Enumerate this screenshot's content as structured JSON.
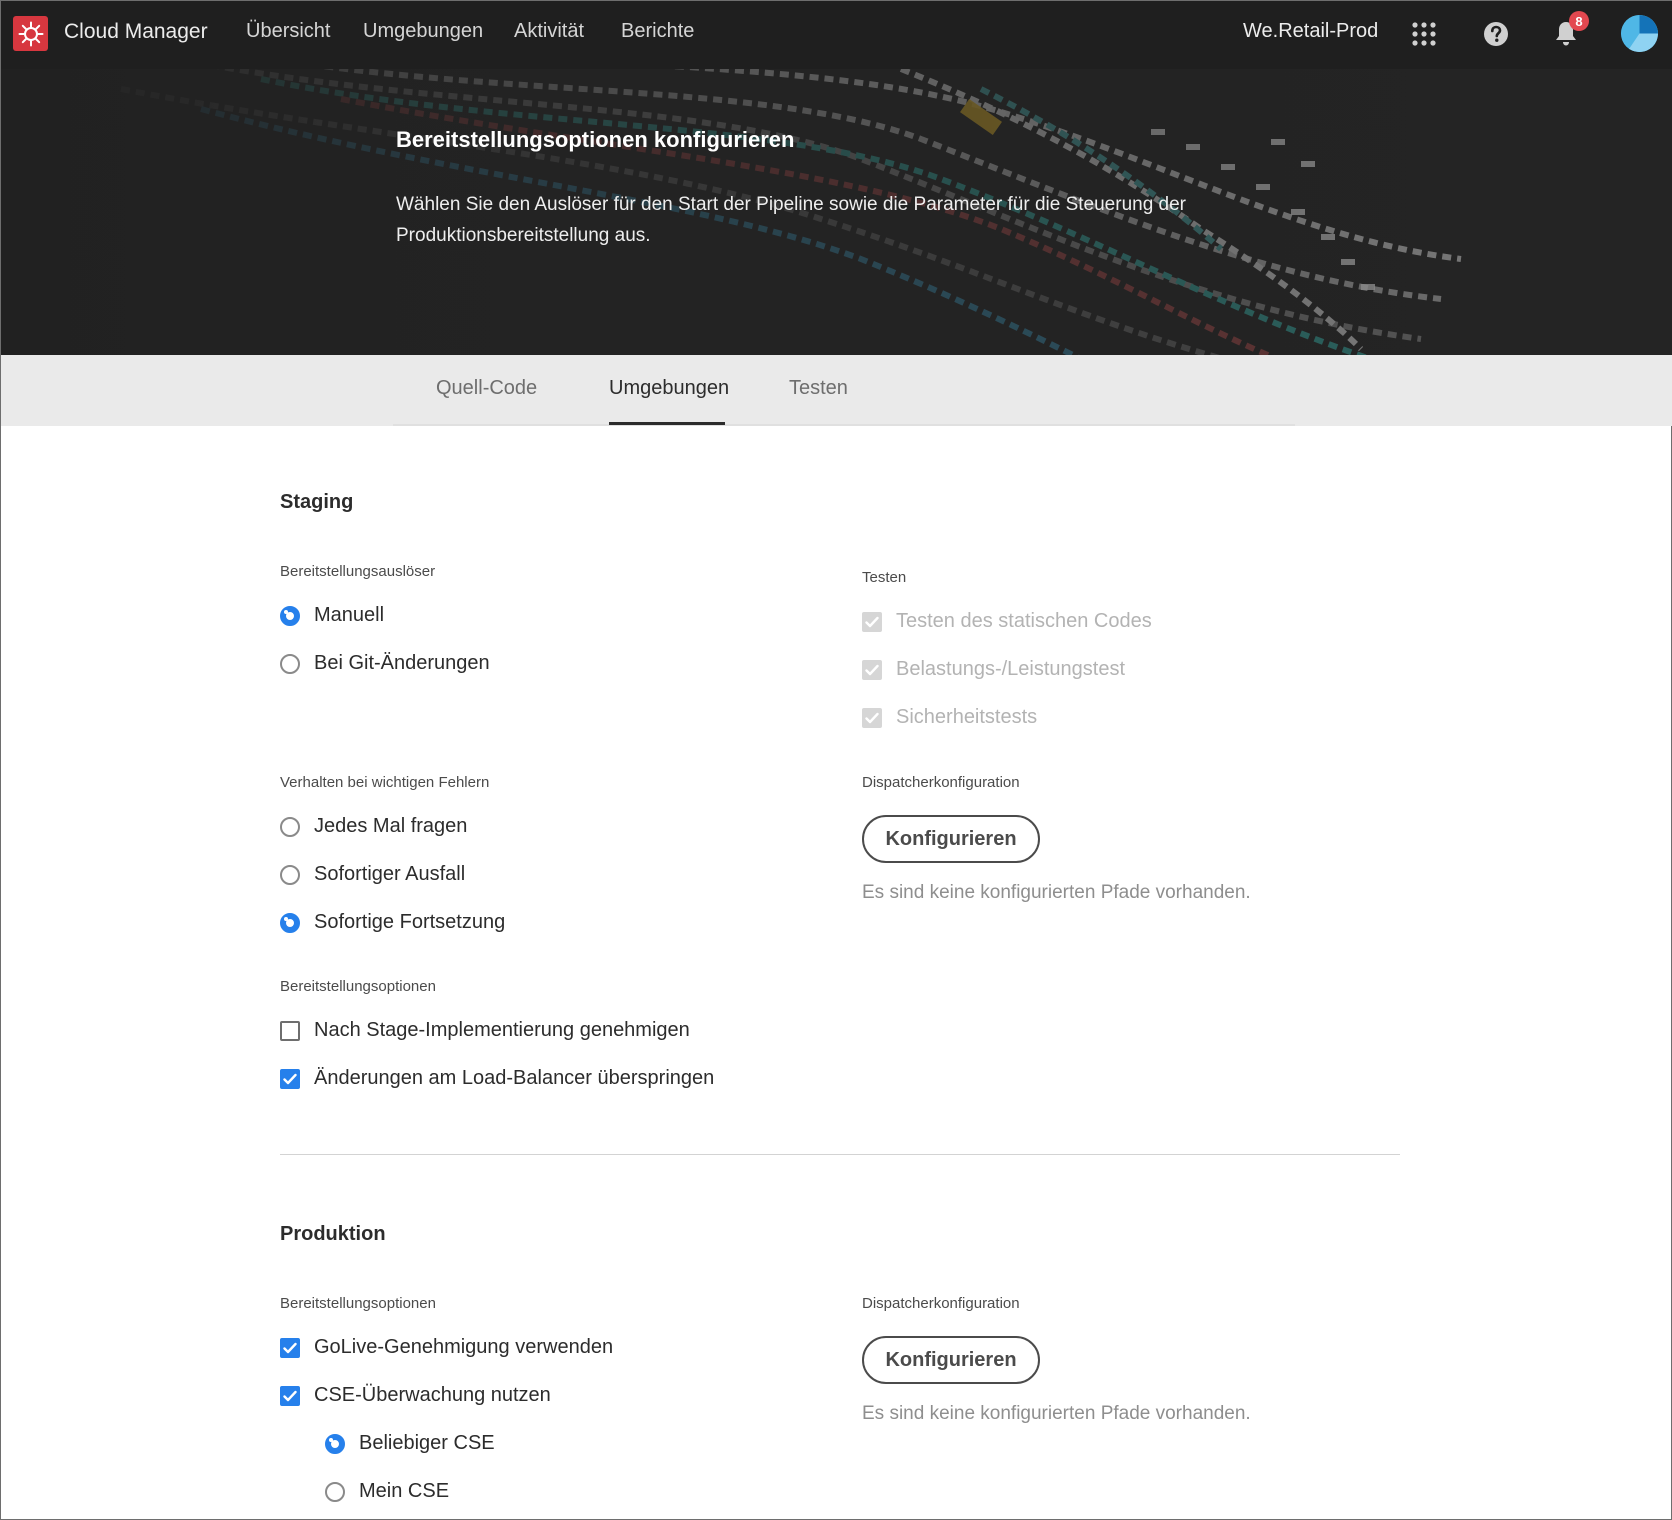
{
  "app": {
    "title": "Cloud Manager",
    "logo_icon": "adobe-experience-cloud-icon",
    "accent_color": "#2680eb",
    "brand_color": "#d7373f"
  },
  "nav": {
    "links": [
      "Übersicht",
      "Umgebungen",
      "Aktivität",
      "Berichte"
    ],
    "org": "We.Retail-Prod",
    "notification_count": "8",
    "icons": [
      "apps-grid-icon",
      "help-icon",
      "bell-icon",
      "avatar"
    ]
  },
  "hero": {
    "title": "Bereitstellungsoptionen konfigurieren",
    "description": "Wählen Sie den Auslöser für den Start der Pipeline sowie die Parameter für die Steuerung der Produktionsbereitstellung aus."
  },
  "tabs": {
    "items": [
      "Quell-Code",
      "Umgebungen",
      "Testen"
    ],
    "active": "Umgebungen"
  },
  "staging": {
    "title": "Staging",
    "trigger": {
      "label": "Bereitstellungsauslöser",
      "options": [
        "Manuell",
        "Bei Git-Änderungen"
      ],
      "selected": "Manuell"
    },
    "failure": {
      "label": "Verhalten bei wichtigen Fehlern",
      "options": [
        "Jedes Mal fragen",
        "Sofortiger Ausfall",
        "Sofortige Fortsetzung"
      ],
      "selected": "Sofortige Fortsetzung"
    },
    "options": {
      "label": "Bereitstellungsoptionen",
      "items": [
        {
          "label": "Nach Stage-Implementierung genehmigen",
          "checked": false
        },
        {
          "label": "Änderungen am Load-Balancer überspringen",
          "checked": true
        }
      ]
    },
    "testing": {
      "label": "Testen",
      "items": [
        "Testen des statischen Codes",
        "Belastungs-/Leistungstest",
        "Sicherheitstests"
      ],
      "checked": true,
      "disabled": true
    },
    "dispatcher": {
      "label": "Dispatcherkonfiguration",
      "button": "Konfigurieren",
      "empty": "Es sind keine konfigurierten Pfade vorhanden."
    }
  },
  "production": {
    "title": "Produktion",
    "options": {
      "label": "Bereitstellungsoptionen",
      "items": [
        {
          "label": "GoLive-Genehmigung verwenden",
          "checked": true
        },
        {
          "label": "CSE-Überwachung nutzen",
          "checked": true
        }
      ],
      "cse": {
        "options": [
          "Beliebiger CSE",
          "Mein CSE"
        ],
        "selected": "Beliebiger CSE"
      }
    },
    "dispatcher": {
      "label": "Dispatcherkonfiguration",
      "button": "Konfigurieren",
      "empty": "Es sind keine konfigurierten Pfade vorhanden."
    }
  }
}
